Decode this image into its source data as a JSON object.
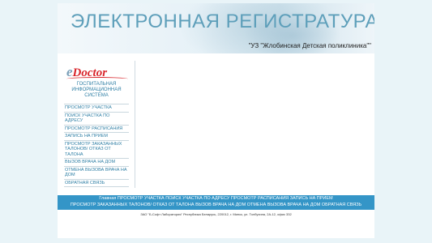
{
  "banner": {
    "title": "ЭЛЕКТРОННАЯ РЕГИСТРАТУРА",
    "subtitle": "\"УЗ \"Жлобинская Детская поликлиника\"\""
  },
  "logo": {
    "e": "e",
    "doctor": "Doctor",
    "caption": "ГОСПИТАЛЬНАЯ ИНФОРМАЦИОННАЯ СИСТЕМА"
  },
  "sidebar": {
    "items": [
      {
        "label": "ПРОСМОТР УЧАСТКА"
      },
      {
        "label": "ПОИСК УЧАСТКА ПО АДРЕСУ"
      },
      {
        "label": "ПРОСМОТР РАСПИСАНИЯ"
      },
      {
        "label": "ЗАПИСЬ НА ПРИЕМ"
      },
      {
        "label": "ПРОСМОТР ЗАКАЗАННЫХ ТАЛОНОВ/ ОТКАЗ ОТ ТАЛОНА"
      },
      {
        "label": "ВЫЗОВ ВРАЧА НА ДОМ"
      },
      {
        "label": "ОТМЕНА ВЫЗОВА ВРАЧА НА ДОМ"
      },
      {
        "label": "ОБРАТНАЯ СВЯЗЬ"
      }
    ]
  },
  "navbar": {
    "items": [
      {
        "label": "Главная"
      },
      {
        "label": "ПРОСМОТР УЧАСТКА"
      },
      {
        "label": "ПОИСК УЧАСТКА ПО АДРЕСУ"
      },
      {
        "label": "ПРОСМОТР РАСПИСАНИЯ"
      },
      {
        "label": "ЗАПИСЬ НА ПРИЕМ"
      },
      {
        "label": "ПРОСМОТР ЗАКАЗАННЫХ ТАЛОНОВ/ ОТКАЗ ОТ ТАЛОНА"
      },
      {
        "label": "ВЫЗОВ ВРАЧА НА ДОМ"
      },
      {
        "label": "ОТМЕНА ВЫЗОВА ВРАЧА НА ДОМ"
      },
      {
        "label": "ОБРАТНАЯ СВЯЗЬ"
      }
    ]
  },
  "footer": {
    "text": "ЗАО \"Б-Софт Лаборатория\" Республика Беларусь, 220012, г. Минск, ул. Толбухина, 2А-12, офис 332"
  },
  "colors": {
    "background": "#e9f4f8",
    "title": "#5e9fba",
    "link": "#2f7fa5",
    "navbar": "#3495c7",
    "logo_red": "#d9262c"
  }
}
